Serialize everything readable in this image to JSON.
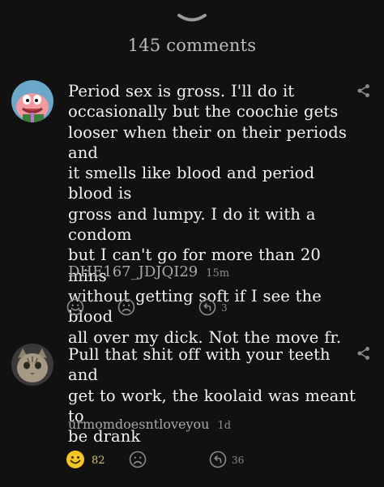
{
  "sheet": {
    "comments_count": "145 comments"
  },
  "comments": [
    {
      "text_lines": [
        "Period sex is gross. I'll do it",
        "occasionally but the coochie gets",
        "looser when their on their periods and",
        "it smells like blood and period blood is",
        "gross and lumpy. I do it with a condom",
        "but I can't go for more than 20 mins",
        "without getting soft if I see the blood",
        "all over my dick. Not the move fr."
      ],
      "username": "DHE167_JDJQI29",
      "time": "15m",
      "reply_count": "3"
    },
    {
      "text_lines": [
        "Pull that shit off with your teeth and",
        "get to work, the koolaid was meant to",
        "be drank"
      ],
      "username": "urmomdoesntloveyou",
      "time": "1d",
      "like_count": "82",
      "reply_count": "36"
    }
  ],
  "colors": {
    "background": "#111111",
    "text": "#f4f4f4",
    "muted": "#a9a9a9",
    "icon": "#8a8a8a",
    "liked": "#f3c623"
  },
  "icons": {
    "handle": "chevron-down-icon",
    "share": "share-icon",
    "like": "smile-icon",
    "dislike": "frown-icon",
    "reply": "reply-icon"
  }
}
